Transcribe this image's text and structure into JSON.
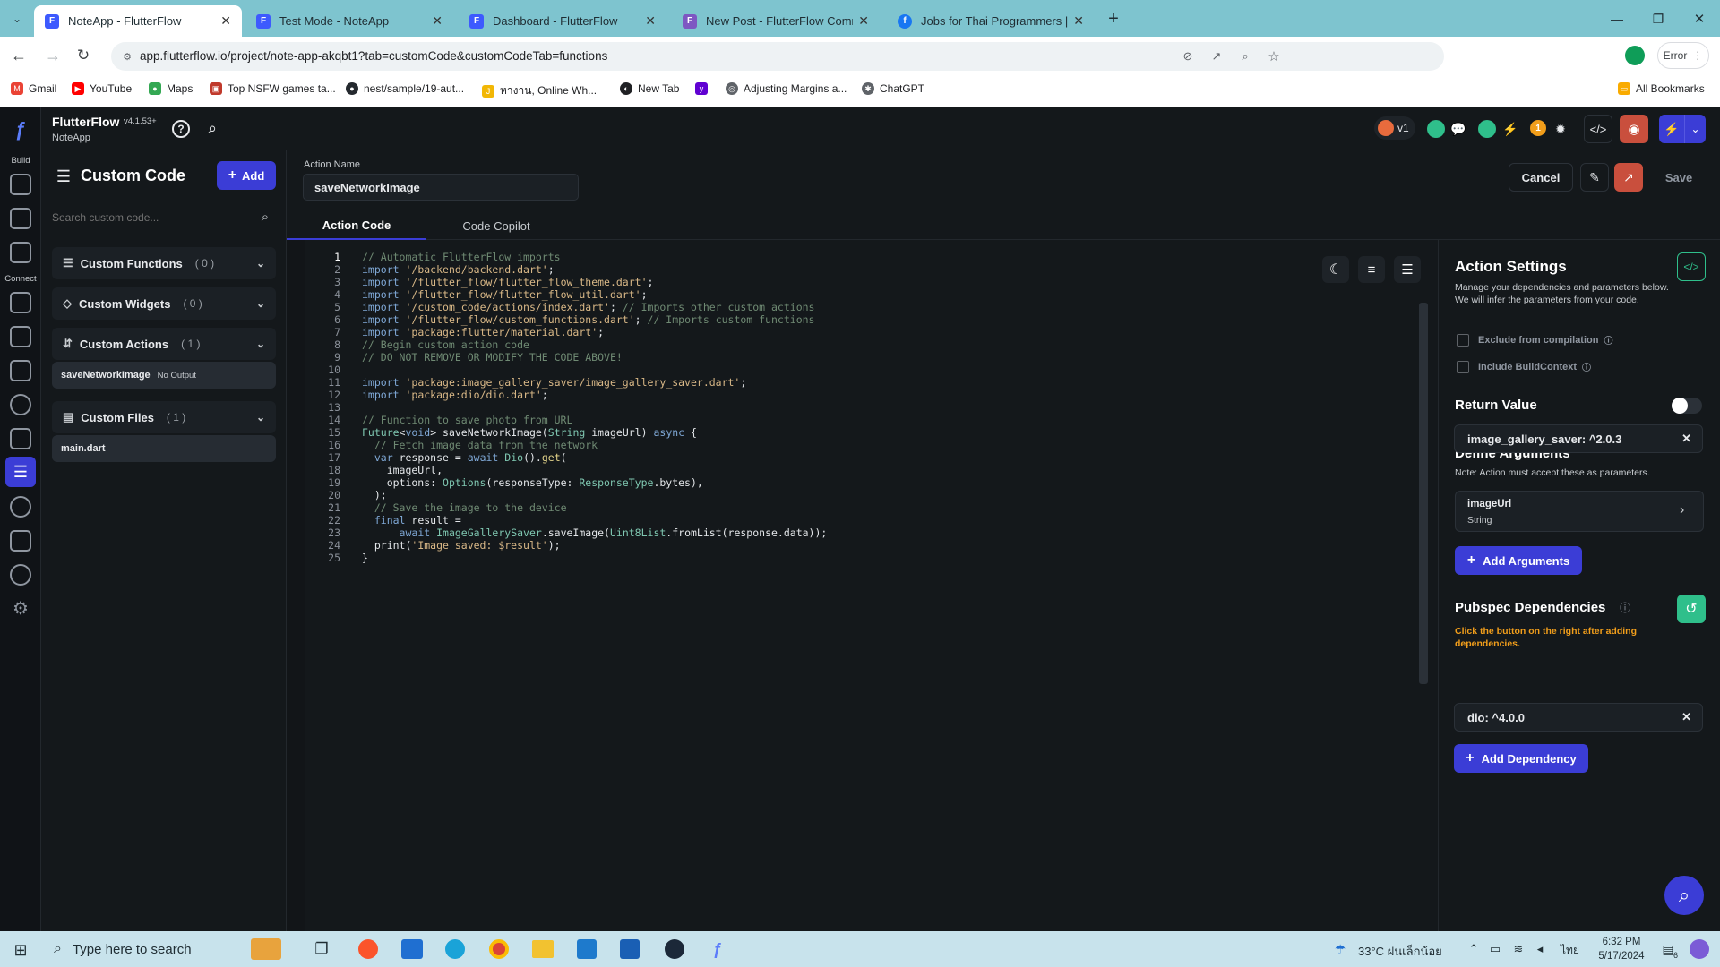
{
  "browser": {
    "tabs": [
      {
        "title": "NoteApp - FlutterFlow",
        "color": "#3d5afe"
      },
      {
        "title": "Test Mode - NoteApp",
        "color": "#3d5afe"
      },
      {
        "title": "Dashboard - FlutterFlow",
        "color": "#3d5afe"
      },
      {
        "title": "New Post - FlutterFlow Commu",
        "color": "#7e57c2"
      },
      {
        "title": "Jobs for Thai Programmers | #",
        "color": "#1877f2"
      }
    ],
    "url": "app.flutterflow.io/project/note-app-akqbt1?tab=customCode&customCodeTab=functions",
    "profile_status": "Error",
    "bookmarks": [
      "Gmail",
      "YouTube",
      "Maps",
      "Top NSFW games ta...",
      "nest/sample/19-aut...",
      "หางาน, Online Wh...",
      "New Tab",
      "",
      "Adjusting Margins a...",
      "ChatGPT"
    ],
    "all_bookmarks": "All Bookmarks"
  },
  "app": {
    "brand": "FlutterFlow",
    "version": "v4.1.53+",
    "project": "NoteApp",
    "rail": {
      "build": "Build",
      "connect": "Connect"
    },
    "version_badge": "v1",
    "warn_count": "1"
  },
  "left": {
    "title": "Custom Code",
    "add": "Add",
    "search_placeholder": "Search custom code...",
    "sections": [
      {
        "label": "Custom Functions",
        "count": "( 0 )"
      },
      {
        "label": "Custom Widgets",
        "count": "( 0 )"
      },
      {
        "label": "Custom Actions",
        "count": "( 1 )"
      },
      {
        "label": "Custom Files",
        "count": "( 1 )"
      }
    ],
    "action_item": {
      "name": "saveNetworkImage",
      "tag": "No Output"
    },
    "file_item": "main.dart"
  },
  "editor": {
    "action_name_label": "Action Name",
    "action_name": "saveNetworkImage",
    "tabs": [
      "Action Code",
      "Code Copilot"
    ],
    "cancel": "Cancel",
    "save": "Save"
  },
  "code_lines": [
    "// Automatic FlutterFlow imports",
    "import '/backend/backend.dart';",
    "import '/flutter_flow/flutter_flow_theme.dart';",
    "import '/flutter_flow/flutter_flow_util.dart';",
    "import '/custom_code/actions/index.dart'; // Imports other custom actions",
    "import '/flutter_flow/custom_functions.dart'; // Imports custom functions",
    "import 'package:flutter/material.dart';",
    "// Begin custom action code",
    "// DO NOT REMOVE OR MODIFY THE CODE ABOVE!",
    "",
    "import 'package:image_gallery_saver/image_gallery_saver.dart';",
    "import 'package:dio/dio.dart';",
    "",
    "// Function to save photo from URL",
    "Future<void> saveNetworkImage(String imageUrl) async {",
    "  // Fetch image data from the network",
    "  var response = await Dio().get(",
    "    imageUrl,",
    "    options: Options(responseType: ResponseType.bytes),",
    "  );",
    "  // Save the image to the device",
    "  final result =",
    "      await ImageGallerySaver.saveImage(Uint8List.fromList(response.data));",
    "  print('Image saved: $result');",
    "}"
  ],
  "settings": {
    "title": "Action Settings",
    "desc1": "Manage your dependencies and parameters below.",
    "desc2": "We will infer the parameters from your code.",
    "exclude": "Exclude from compilation",
    "include_ctx": "Include BuildContext",
    "return_value": "Return Value",
    "define_args": "Define Arguments",
    "args_note": "Note: Action must accept these as parameters.",
    "arg_name": "imageUrl",
    "arg_type": "String",
    "add_args": "Add Arguments",
    "pubspec": "Pubspec Dependencies",
    "pubspec_note": "Click the button on the right after adding dependencies.",
    "deps": [
      "image_gallery_saver: ^2.0.3",
      "dio: ^4.0.0"
    ],
    "add_dep": "Add Dependency"
  },
  "taskbar": {
    "search": "Type here to search",
    "weather": "33°C ฝนเล็กน้อย",
    "lang": "ไทย",
    "time": "6:32 PM",
    "date": "5/17/2024",
    "notif": "6"
  }
}
